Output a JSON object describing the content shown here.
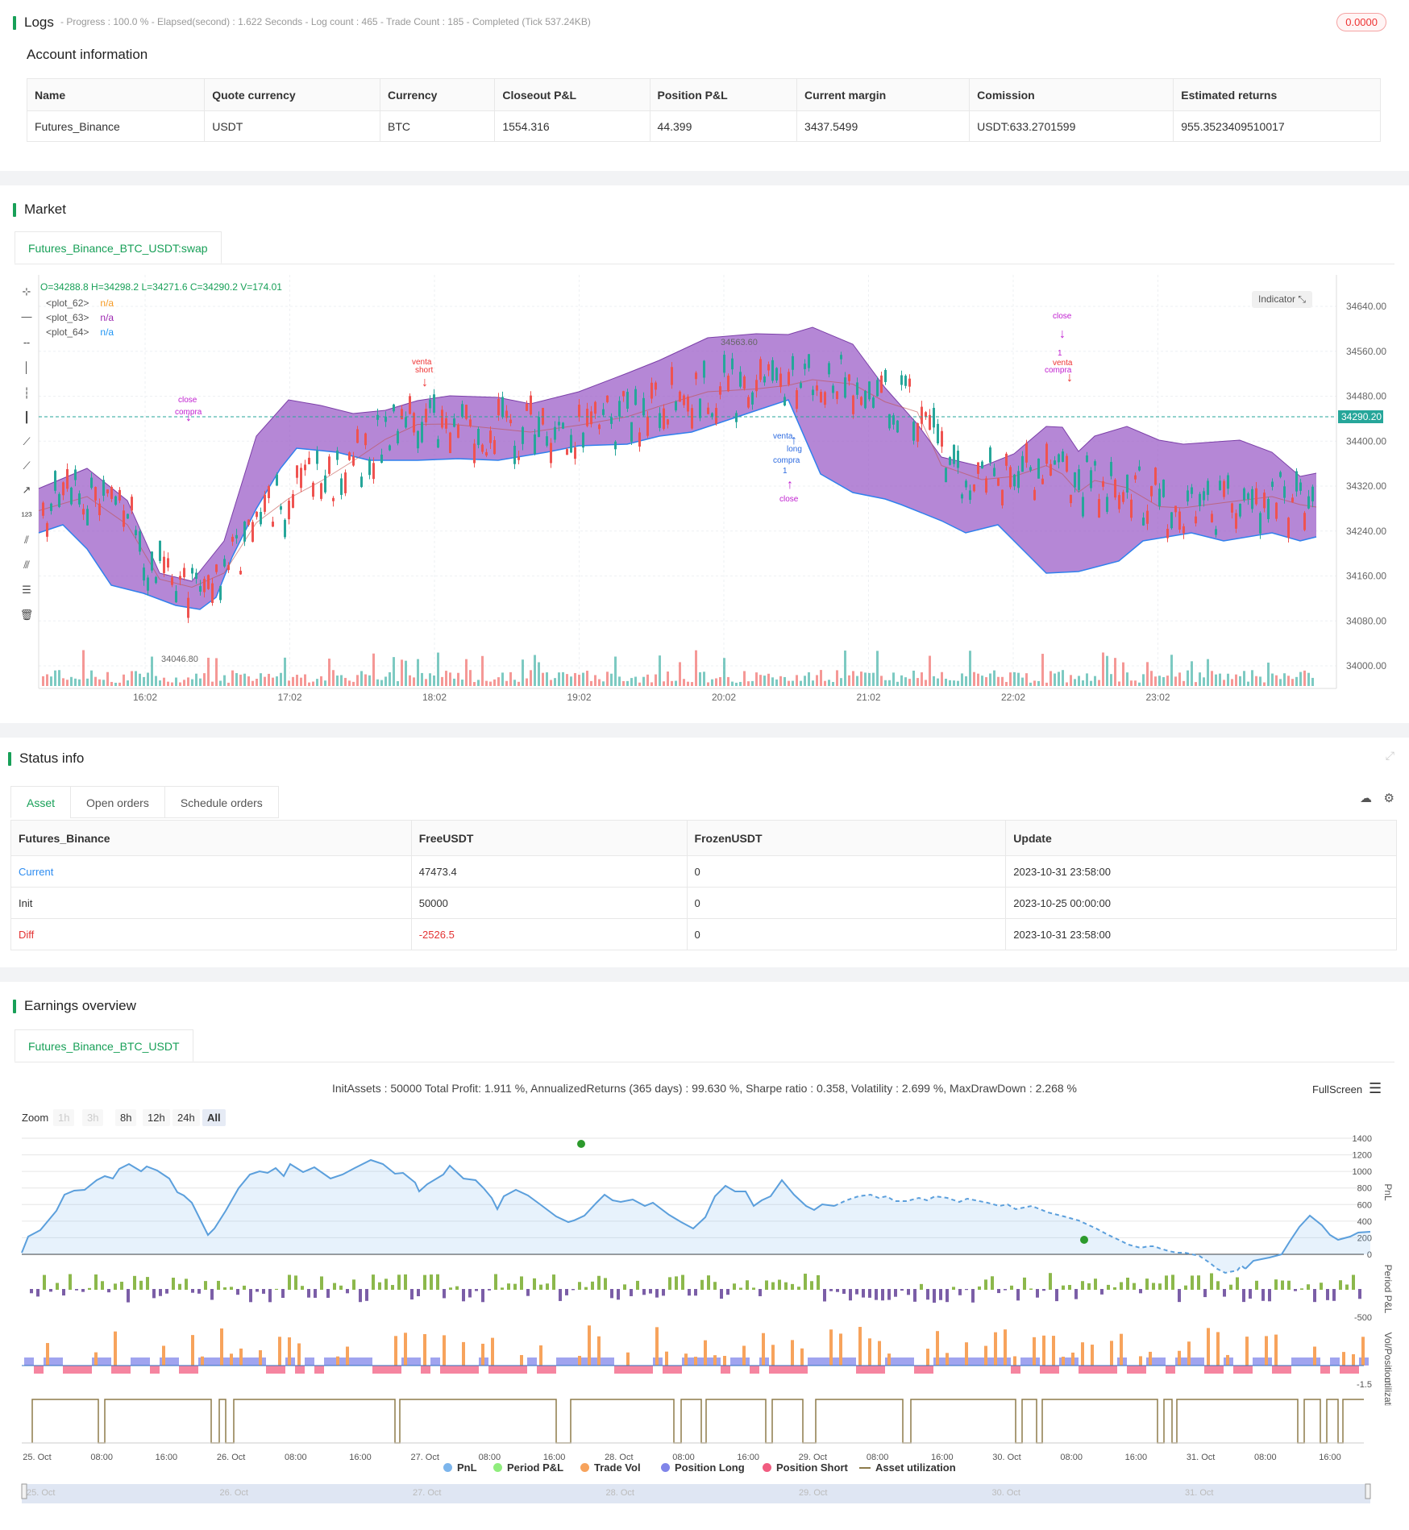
{
  "logs": {
    "title": "Logs",
    "progress_line": "- Progress : 100.0 % - Elapsed(second) : 1.622  Seconds - Log count : 465 - Trade Count : 185 - Completed (Tick 537.24KB)",
    "badge": "0.0000",
    "account_title": "Account information",
    "columns": [
      "Name",
      "Quote currency",
      "Currency",
      "Closeout P&L",
      "Position P&L",
      "Current margin",
      "Comission",
      "Estimated returns"
    ],
    "row": [
      "Futures_Binance",
      "USDT",
      "BTC",
      "1554.316",
      "44.399",
      "3437.5499",
      "USDT:633.2701599",
      "955.3523409510017"
    ]
  },
  "market": {
    "title": "Market",
    "tab": "Futures_Binance_BTC_USDT:swap",
    "ohlc": "O=34288.8 H=34298.2 L=34271.6 C=34290.2 V=174.01",
    "plots": [
      {
        "name": "<plot_62>",
        "value": "n/a",
        "color": "#f59a23"
      },
      {
        "name": "<plot_63>",
        "value": "n/a",
        "color": "#9c27b0"
      },
      {
        "name": "<plot_64>",
        "value": "n/a",
        "color": "#2196f3"
      }
    ],
    "indicator_button": "Indicator",
    "price_ticks": [
      "34640.00",
      "34560.00",
      "34480.00",
      "34400.00",
      "34320.00",
      "34240.00",
      "34160.00",
      "34080.00",
      "34000.00"
    ],
    "time_ticks": [
      "16:02",
      "17:02",
      "18:02",
      "19:02",
      "20:02",
      "21:02",
      "22:02",
      "23:02"
    ],
    "last_price": "34290.20",
    "high_marker": "34563.60",
    "low_marker": "34046.80",
    "labels": {
      "short": "short",
      "venta": "venta",
      "close": "close",
      "compra": "compra",
      "long": "long",
      "one": "1"
    }
  },
  "status": {
    "title": "Status info",
    "tabs": [
      "Asset",
      "Open orders",
      "Schedule orders"
    ],
    "columns": [
      "Futures_Binance",
      "FreeUSDT",
      "FrozenUSDT",
      "Update"
    ],
    "rows": [
      {
        "label": "Current",
        "free": "47473.4",
        "frozen": "0",
        "update": "2023-10-31 23:58:00",
        "color": "#2d8cf0"
      },
      {
        "label": "Init",
        "free": "50000",
        "frozen": "0",
        "update": "2023-10-25 00:00:00",
        "color": "#333333"
      },
      {
        "label": "Diff",
        "free": "-2526.5",
        "frozen": "0",
        "update": "2023-10-31 23:58:00",
        "color": "#e33333"
      }
    ]
  },
  "earnings": {
    "title": "Earnings overview",
    "tab": "Futures_Binance_BTC_USDT",
    "summary": "InitAssets : 50000 Total Profit: 1.911 %, AnnualizedReturns (365 days) : 99.630 %, Sharpe ratio : 0.358, Volatility : 2.699 %, MaxDrawDown : 2.268 %",
    "fullscreen": "FullScreen",
    "zoom_label": "Zoom",
    "zoom_buttons": [
      "1h",
      "3h",
      "8h",
      "12h",
      "24h",
      "All"
    ],
    "pnl_ticks": [
      "1400",
      "1200",
      "1000",
      "800",
      "600",
      "400",
      "200",
      "0"
    ],
    "period_ticks": [
      "-500"
    ],
    "vol_ticks": [
      "-1.5"
    ],
    "axis_titles": [
      "PnL",
      "Period P&L",
      "Vol/Position",
      "utilization"
    ],
    "x_ticks": [
      "25. Oct",
      "08:00",
      "16:00",
      "26. Oct",
      "08:00",
      "16:00",
      "27. Oct",
      "08:00",
      "16:00",
      "28. Oct",
      "08:00",
      "16:00",
      "29. Oct",
      "08:00",
      "16:00",
      "30. Oct",
      "08:00",
      "16:00",
      "31. Oct",
      "08:00",
      "16:00"
    ],
    "legend": [
      {
        "label": "PnL",
        "color": "#7cb5ec"
      },
      {
        "label": "Period P&L",
        "color": "#90ed7d"
      },
      {
        "label": "Trade Vol",
        "color": "#f7a35c"
      },
      {
        "label": "Position Long",
        "color": "#8085e9"
      },
      {
        "label": "Position Short",
        "color": "#f15c80"
      },
      {
        "label": "Asset utilization",
        "color": "#8d7b4a"
      }
    ],
    "navigator_ticks": [
      "25. Oct",
      "26. Oct",
      "27. Oct",
      "28. Oct",
      "29. Oct",
      "30. Oct",
      "31. Oct"
    ]
  }
}
